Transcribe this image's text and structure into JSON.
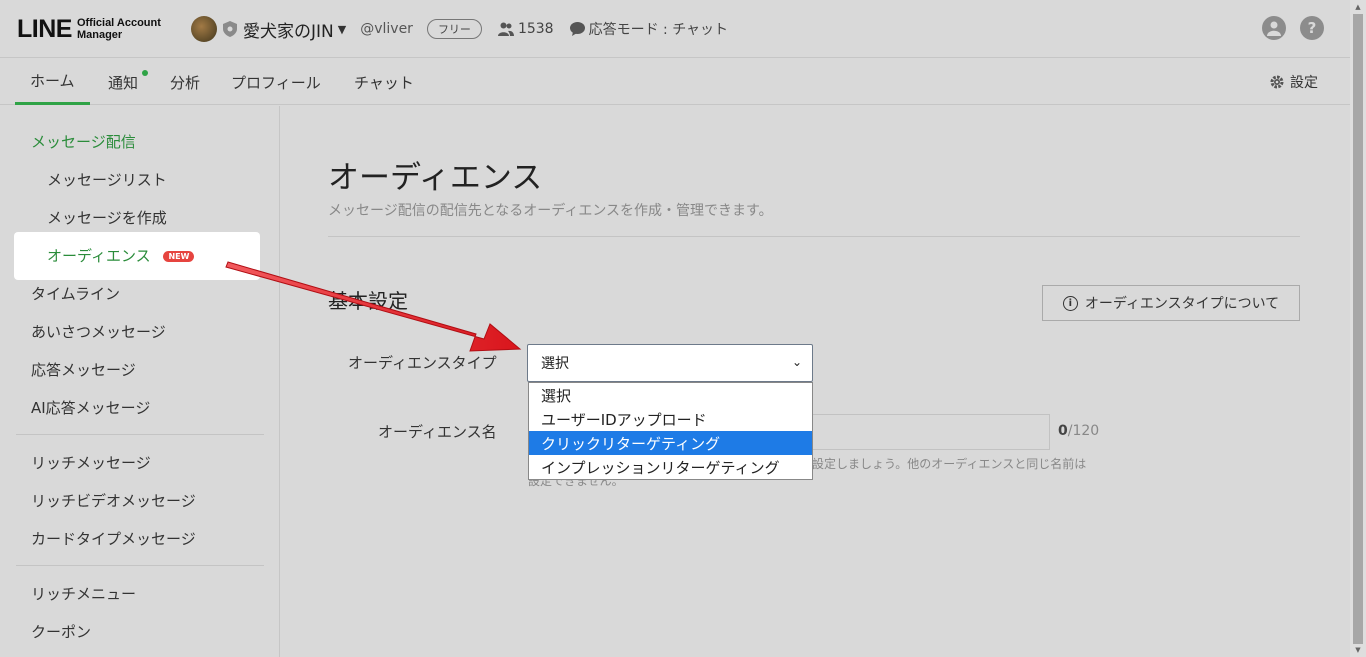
{
  "header": {
    "logo_main": "LINE",
    "logo_sub_1": "Official Account",
    "logo_sub_2": "Manager",
    "account_name": "愛犬家のJIN",
    "handle": "@vliver",
    "plan": "フリー",
    "friends_count": "1538",
    "response_mode": "応答モード : チャット",
    "help_glyph": "?"
  },
  "nav": {
    "tabs": [
      {
        "label": "ホーム"
      },
      {
        "label": "通知"
      },
      {
        "label": "分析"
      },
      {
        "label": "プロフィール"
      },
      {
        "label": "チャット"
      }
    ],
    "settings": "設定"
  },
  "sidebar": {
    "section_message": "メッセージ配信",
    "items": [
      {
        "label": "メッセージリスト"
      },
      {
        "label": "メッセージを作成"
      },
      {
        "label": "オーディエンス",
        "badge": "NEW"
      },
      {
        "label": "タイムライン"
      },
      {
        "label": "あいさつメッセージ"
      },
      {
        "label": "応答メッセージ"
      },
      {
        "label": "AI応答メッセージ"
      },
      {
        "label": "リッチメッセージ"
      },
      {
        "label": "リッチビデオメッセージ"
      },
      {
        "label": "カードタイプメッセージ"
      },
      {
        "label": "リッチメニュー"
      },
      {
        "label": "クーポン"
      }
    ]
  },
  "main": {
    "title": "オーディエンス",
    "subtitle": "メッセージ配信の配信先となるオーディエンスを作成・管理できます。",
    "section_title": "基本設定",
    "about_button": "オーディエンスタイプについて",
    "type_label": "オーディエンスタイプ",
    "name_label": "オーディエンス名",
    "counter_current": "0",
    "counter_max": "/120",
    "help_line_1": "設定しましょう。他のオーディエンスと同じ名前は",
    "help_line_2": "設定できません。"
  },
  "audience_type_select": {
    "selected": "選択",
    "options": [
      {
        "label": "選択"
      },
      {
        "label": "ユーザーIDアップロード"
      },
      {
        "label": "クリックリターゲティング"
      },
      {
        "label": "インプレッションリターゲティング"
      }
    ],
    "highlighted_option": "クリックリターゲティング"
  },
  "colors": {
    "brand_green": "#2fa346",
    "highlight_blue": "#1e7be6",
    "arrow_red": "#e31f25",
    "new_badge": "#e6443f"
  }
}
